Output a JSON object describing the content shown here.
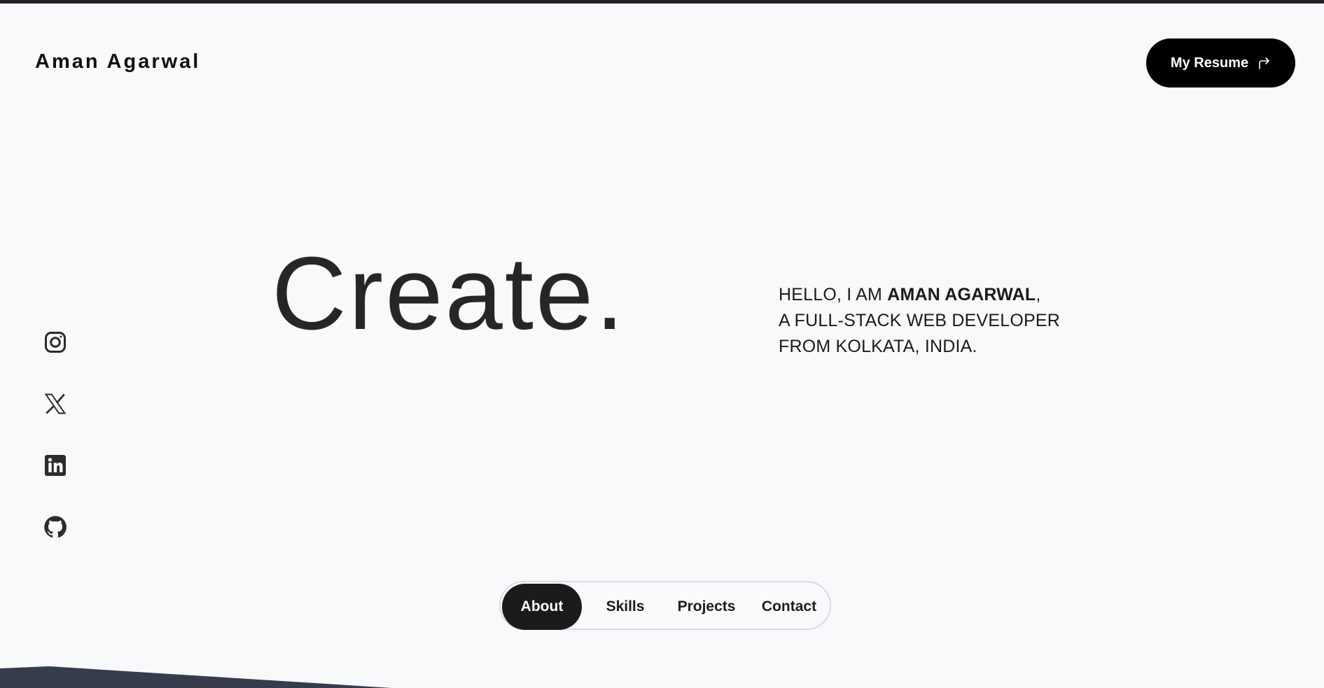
{
  "header": {
    "brand": "Aman Agarwal",
    "resume_label": "My Resume",
    "resume_icon": "external-arrow-icon"
  },
  "hero": {
    "headline": "Create."
  },
  "intro": {
    "prefix": "HELLO, I AM ",
    "name": "AMAN AGARWAL",
    "suffix": ",",
    "line2": "A FULL-STACK WEB DEVELOPER",
    "line3": "FROM KOLKATA, INDIA."
  },
  "socials": [
    {
      "icon": "instagram-icon"
    },
    {
      "icon": "x-twitter-icon"
    },
    {
      "icon": "linkedin-icon"
    },
    {
      "icon": "github-icon"
    }
  ],
  "nav": {
    "items": [
      {
        "label": "About",
        "active": true
      },
      {
        "label": "Skills",
        "active": false
      },
      {
        "label": "Projects",
        "active": false
      },
      {
        "label": "Contact",
        "active": false
      }
    ]
  },
  "colors": {
    "background": "#f8f9fb",
    "primary": "#000000",
    "text": "#1f2023",
    "accent_shape": "#363c4c",
    "pill_border": "#d7dbe6"
  }
}
